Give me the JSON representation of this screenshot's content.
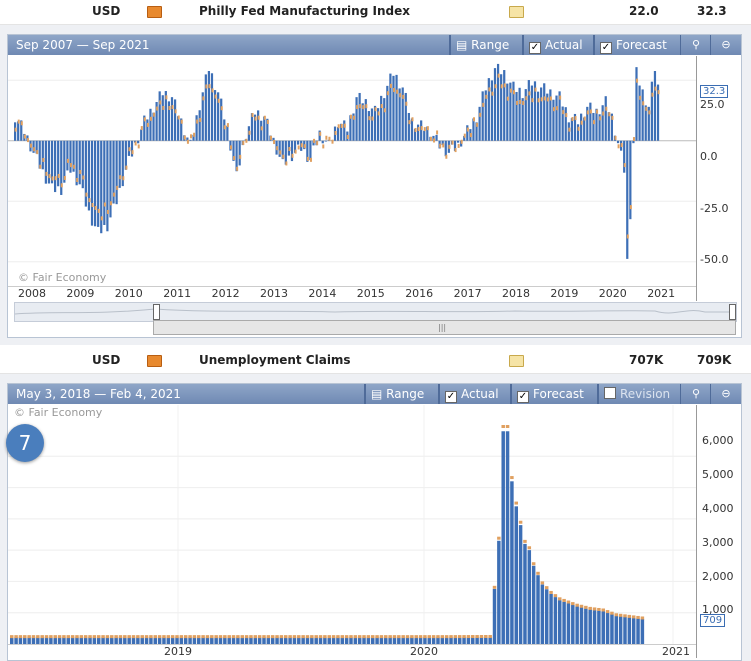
{
  "rows": [
    {
      "currency": "USD",
      "event": "Philly Fed Manufacturing Index",
      "actual": "22.0",
      "forecast": "32.3"
    },
    {
      "currency": "USD",
      "event": "Unemployment Claims",
      "actual": "707K",
      "forecast": "709K"
    }
  ],
  "chart1": {
    "date_range": "Sep 2007 — Sep 2021",
    "range_label": "Range",
    "actual_label": "Actual",
    "forecast_label": "Forecast",
    "copyright": "© Fair Economy",
    "last_value": "32.3",
    "y_ticks": [
      "25.0",
      "0.0",
      "-25.0",
      "-50.0"
    ],
    "x_ticks": [
      "2008",
      "2009",
      "2010",
      "2011",
      "2012",
      "2013",
      "2014",
      "2015",
      "2016",
      "2017",
      "2018",
      "2019",
      "2020",
      "2021"
    ]
  },
  "chart2": {
    "date_range": "May 3, 2018 — Feb 4, 2021",
    "range_label": "Range",
    "actual_label": "Actual",
    "forecast_label": "Forecast",
    "revision_label": "Revision",
    "copyright": "© Fair Economy",
    "last_value": "709",
    "y_ticks": [
      "6,000",
      "5,000",
      "4,000",
      "3,000",
      "2,000",
      "1,000"
    ],
    "x_ticks": [
      "2019",
      "2020",
      "2021"
    ]
  },
  "badge": "7",
  "colors": {
    "actual": "#3d6fb6",
    "forecast": "#e0a060",
    "header": "#7f97bf"
  },
  "chart_data": [
    {
      "type": "bar",
      "title": "Philly Fed Manufacturing Index",
      "ylim": [
        -60,
        35
      ],
      "x": [
        "2007-09",
        "2021-09"
      ],
      "anchors": [
        [
          0,
          10
        ],
        [
          3,
          4
        ],
        [
          6,
          -5
        ],
        [
          9,
          -13
        ],
        [
          12,
          -20
        ],
        [
          15,
          -20
        ],
        [
          18,
          -12
        ],
        [
          21,
          -18
        ],
        [
          24,
          -30
        ],
        [
          27,
          -38
        ],
        [
          30,
          -35
        ],
        [
          33,
          -25
        ],
        [
          36,
          -12
        ],
        [
          39,
          -2
        ],
        [
          42,
          8
        ],
        [
          45,
          14
        ],
        [
          48,
          20
        ],
        [
          51,
          18
        ],
        [
          54,
          8
        ],
        [
          57,
          -2
        ],
        [
          60,
          15
        ],
        [
          63,
          30
        ],
        [
          66,
          20
        ],
        [
          69,
          5
        ],
        [
          72,
          -15
        ],
        [
          75,
          3
        ],
        [
          78,
          12
        ],
        [
          81,
          10
        ],
        [
          84,
          0
        ],
        [
          87,
          -10
        ],
        [
          90,
          -6
        ],
        [
          93,
          -3
        ],
        [
          96,
          -8
        ],
        [
          99,
          3
        ],
        [
          102,
          -2
        ],
        [
          105,
          8
        ],
        [
          108,
          5
        ],
        [
          111,
          18
        ],
        [
          114,
          16
        ],
        [
          117,
          12
        ],
        [
          120,
          20
        ],
        [
          123,
          28
        ],
        [
          126,
          22
        ],
        [
          129,
          8
        ],
        [
          132,
          6
        ],
        [
          135,
          4
        ],
        [
          138,
          -2
        ],
        [
          141,
          -5
        ],
        [
          144,
          -2
        ],
        [
          147,
          4
        ],
        [
          150,
          10
        ],
        [
          153,
          22
        ],
        [
          156,
          30
        ],
        [
          159,
          28
        ],
        [
          162,
          22
        ],
        [
          165,
          20
        ],
        [
          168,
          24
        ],
        [
          171,
          22
        ],
        [
          174,
          20
        ],
        [
          177,
          18
        ],
        [
          180,
          10
        ],
        [
          183,
          8
        ],
        [
          186,
          14
        ],
        [
          189,
          12
        ],
        [
          192,
          16
        ],
        [
          194,
          10
        ],
        [
          198,
          -12
        ],
        [
          199,
          -50
        ],
        [
          200,
          -30
        ],
        [
          202,
          28
        ],
        [
          204,
          20
        ],
        [
          206,
          14
        ],
        [
          208,
          30
        ],
        [
          209,
          22
        ]
      ]
    },
    {
      "type": "bar",
      "title": "Unemployment Claims",
      "ylim": [
        0,
        7000
      ],
      "x": [
        "2018-05-03",
        "2021-02-04"
      ],
      "anchors": [
        [
          0,
          215
        ],
        [
          50,
          215
        ],
        [
          100,
          215
        ],
        [
          110,
          220
        ],
        [
          112,
          3300
        ],
        [
          113,
          6800
        ],
        [
          114,
          6800
        ],
        [
          115,
          5200
        ],
        [
          116,
          4400
        ],
        [
          117,
          3800
        ],
        [
          118,
          3200
        ],
        [
          119,
          3000
        ],
        [
          120,
          2500
        ],
        [
          122,
          1900
        ],
        [
          124,
          1600
        ],
        [
          126,
          1400
        ],
        [
          128,
          1300
        ],
        [
          130,
          1200
        ],
        [
          133,
          1100
        ],
        [
          136,
          1050
        ],
        [
          139,
          900
        ],
        [
          142,
          850
        ],
        [
          145,
          800
        ]
      ]
    }
  ]
}
